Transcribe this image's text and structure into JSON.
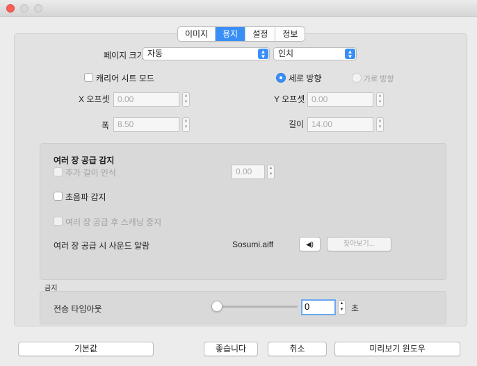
{
  "tabs": [
    {
      "label": "이미지",
      "active": false
    },
    {
      "label": "용지",
      "active": true
    },
    {
      "label": "설정",
      "active": false
    },
    {
      "label": "정보",
      "active": false
    }
  ],
  "page_size": {
    "label": "페이지 크기",
    "value": "자동",
    "unit": "인치"
  },
  "carrier_sheet": {
    "label": "캐리어 시트 모드",
    "checked": false
  },
  "orientation": {
    "portrait": "세로 방향",
    "landscape": "가로 방향",
    "selected": "portrait"
  },
  "x_offset": {
    "label": "X 오프셋",
    "value": "0.00"
  },
  "y_offset": {
    "label": "Y 오프셋",
    "value": "0.00"
  },
  "width": {
    "label": "폭",
    "value": "8.50"
  },
  "length": {
    "label": "길이",
    "value": "14.00"
  },
  "multifeed": {
    "title": "여러 장 공급 감지",
    "extra_length": {
      "label": "추가 길이 인식",
      "value": "0.00"
    },
    "ultrasonic": "초음파 감지",
    "stop_scan": "여러 장 공급 후 스캐닝 중지",
    "sound_alarm": "여러 장 공급 시 사운드 알람",
    "sound_file": "Sosumi.aiff",
    "browse": "찾아보기..."
  },
  "section2": {
    "title": "금지",
    "timeout_label": "전송 타임아웃",
    "timeout_value": "0",
    "timeout_unit": "초",
    "slider_level": 0
  },
  "buttons": {
    "defaults": "기본값",
    "ok": "좋습니다",
    "cancel": "취소",
    "preview": "미리보기 윈도우"
  },
  "colors": {
    "accent": "#3a8ff6",
    "close": "#fc5f57"
  }
}
